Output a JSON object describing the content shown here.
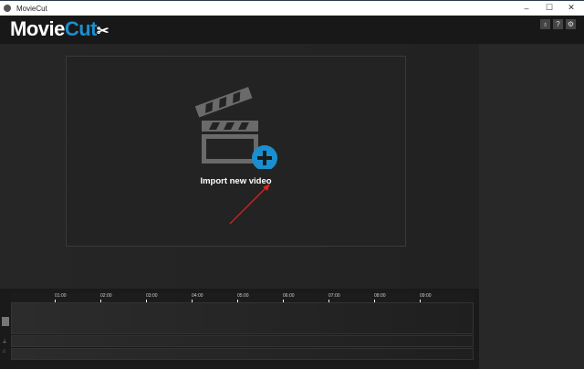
{
  "window": {
    "title": "MovieCut",
    "minimize": "–",
    "maximize": "☐",
    "close": "✕"
  },
  "header": {
    "logo_main": "Movie",
    "logo_accent": "Cut",
    "accent_color": "#1a8fd0",
    "buttons": [
      {
        "icon": "lightbulb-icon",
        "glyph": "💡"
      },
      {
        "icon": "help-icon",
        "glyph": "?"
      },
      {
        "icon": "gear-icon",
        "glyph": "⚙"
      }
    ]
  },
  "main": {
    "import_label": "Import new video",
    "plus_color": "#1a8fd0"
  },
  "timeline": {
    "ticks": [
      "01:00",
      "02:00",
      "03:00",
      "04:00",
      "05:00",
      "06:00",
      "07:00",
      "08:00",
      "09:00"
    ],
    "tracks": [
      "video-track",
      "audio-track",
      "music-track"
    ]
  }
}
